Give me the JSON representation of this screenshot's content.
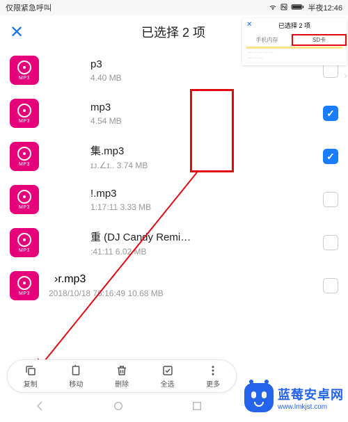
{
  "statusbar": {
    "left": "仅限紧急呼叫",
    "time": "半夜12:46"
  },
  "titlebar": {
    "title": "已选择 2 项"
  },
  "files": [
    {
      "name": "p3",
      "sub": "4.40 MB",
      "checked": false
    },
    {
      "name": "mp3",
      "sub": "4.54 MB",
      "checked": true
    },
    {
      "name": "集.mp3",
      "sub": "ɪᴊ.∠ɪ.. 3.74 MB",
      "checked": true
    },
    {
      "name": "!.mp3",
      "sub": "1:17:11 3.33 MB",
      "checked": false
    },
    {
      "name": "重 (DJ Candy Remix).m…",
      "sub": ":41:11 6.02 MB",
      "checked": false
    },
    {
      "name": "›r.mp3",
      "sub": "2018/10/18 76:16:49 10.68 MB",
      "checked": false,
      "wide": true
    }
  ],
  "icon_label": "MP3",
  "actions": {
    "copy": "复制",
    "move": "移动",
    "delete": "删除",
    "selectall": "全选",
    "more": "更多"
  },
  "overlay": {
    "title": "已选择 2 项",
    "tab_phone": "手机内存",
    "tab_sd": "SD卡"
  },
  "brand": {
    "name": "蓝莓安卓网",
    "url": "www.lmkjst.com"
  }
}
